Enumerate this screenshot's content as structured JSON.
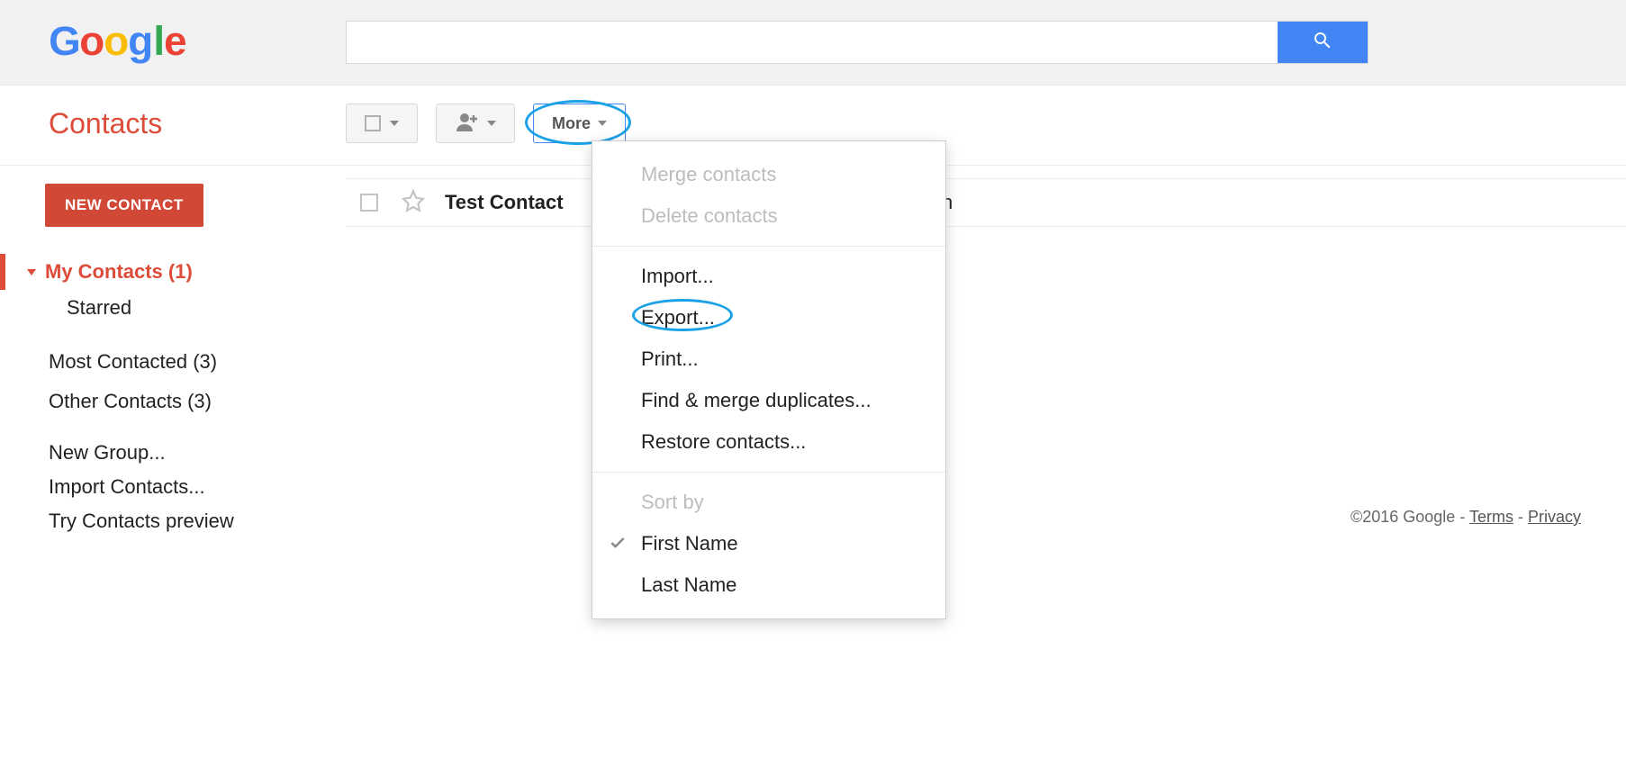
{
  "header": {
    "search_placeholder": "",
    "logo": {
      "g": "G",
      "o1": "o",
      "o2": "o",
      "g2": "g",
      "l": "l",
      "e": "e",
      "colors": {
        "blue": "#4285f4",
        "red": "#ea4335",
        "yellow": "#fbbc05",
        "green": "#34a853"
      }
    }
  },
  "page_title": "Contacts",
  "toolbar": {
    "more_label": "More"
  },
  "sidebar": {
    "new_contact": "NEW CONTACT",
    "my_contacts": "My Contacts (1)",
    "starred": "Starred",
    "most_contacted": "Most Contacted (3)",
    "other_contacts": "Other Contacts (3)",
    "new_group": "New Group...",
    "import_contacts": "Import Contacts...",
    "try_preview": "Try Contacts preview"
  },
  "contact": {
    "name": "Test Contact",
    "trailing_glyph": "n"
  },
  "menu": {
    "merge": "Merge contacts",
    "delete": "Delete contacts",
    "import": "Import...",
    "export": "Export...",
    "print": "Print...",
    "find_dup": "Find & merge duplicates...",
    "restore": "Restore contacts...",
    "sort_by": "Sort by",
    "first_name": "First Name",
    "last_name": "Last Name"
  },
  "footer": {
    "copyright": "©2016 Google",
    "sep": " - ",
    "terms": "Terms",
    "privacy": "Privacy"
  }
}
